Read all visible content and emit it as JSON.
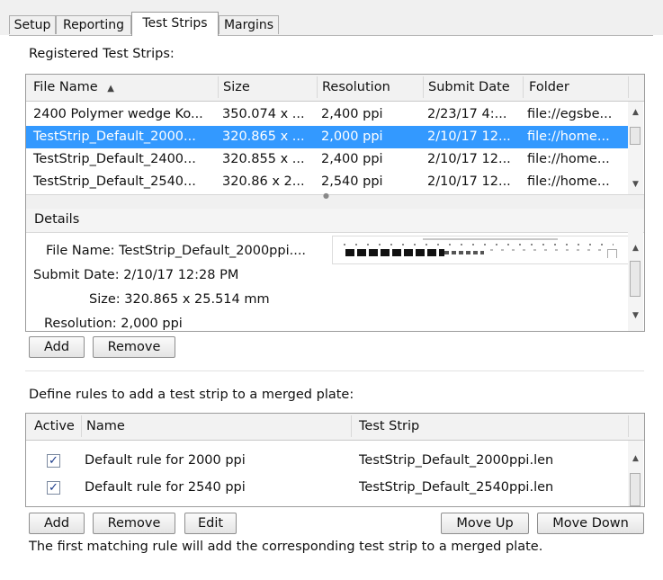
{
  "tabs": [
    {
      "label": "Setup"
    },
    {
      "label": "Reporting"
    },
    {
      "label": "Test Strips"
    },
    {
      "label": "Margins"
    }
  ],
  "registered": {
    "heading": "Registered Test Strips:",
    "columns": [
      "File Name",
      "Size",
      "Resolution",
      "Submit Date",
      "Folder"
    ],
    "rows": [
      {
        "name": "2400 Polymer wedge Ko...",
        "size": "350.074 x ...",
        "resolution": "2,400 ppi",
        "date": "2/23/17 4:...",
        "folder": "file://egsbe..."
      },
      {
        "name": "TestStrip_Default_2000...",
        "size": "320.865 x ...",
        "resolution": "2,000 ppi",
        "date": "2/10/17 12...",
        "folder": "file://home..."
      },
      {
        "name": "TestStrip_Default_2400...",
        "size": "320.855 x ...",
        "resolution": "2,400 ppi",
        "date": "2/10/17 12...",
        "folder": "file://home..."
      },
      {
        "name": "TestStrip_Default_2540...",
        "size": "320.86 x 2...",
        "resolution": "2,540 ppi",
        "date": "2/10/17 12...",
        "folder": "file://home..."
      }
    ],
    "selected_index": 1
  },
  "details": {
    "heading": "Details",
    "file_name": "File Name: TestStrip_Default_2000ppi....",
    "submit_date": "Submit Date: 2/10/17 12:28 PM",
    "size": "Size: 320.865 x 25.514 mm",
    "resolution": "Resolution: 2,000 ppi"
  },
  "strip_buttons": {
    "add": "Add",
    "remove": "Remove"
  },
  "rules": {
    "heading": "Define rules to add a test strip to a merged plate:",
    "columns": [
      "Active",
      "Name",
      "Test Strip"
    ],
    "rows": [
      {
        "active": true,
        "name": "Default rule for 2000 ppi",
        "strip": "TestStrip_Default_2000ppi.len"
      },
      {
        "active": true,
        "name": "Default rule for 2540 ppi",
        "strip": "TestStrip_Default_2540ppi.len"
      }
    ]
  },
  "rule_buttons": {
    "add": "Add",
    "remove": "Remove",
    "edit": "Edit",
    "move_up": "Move Up",
    "move_down": "Move Down"
  },
  "footer_note": "The first matching rule will add the corresponding test strip to a merged plate.",
  "colors": {
    "selection": "#3399ff",
    "check": "#1a3a8a"
  },
  "icons": {
    "sort": "sort-ascending-icon",
    "check": "checkmark-icon"
  }
}
